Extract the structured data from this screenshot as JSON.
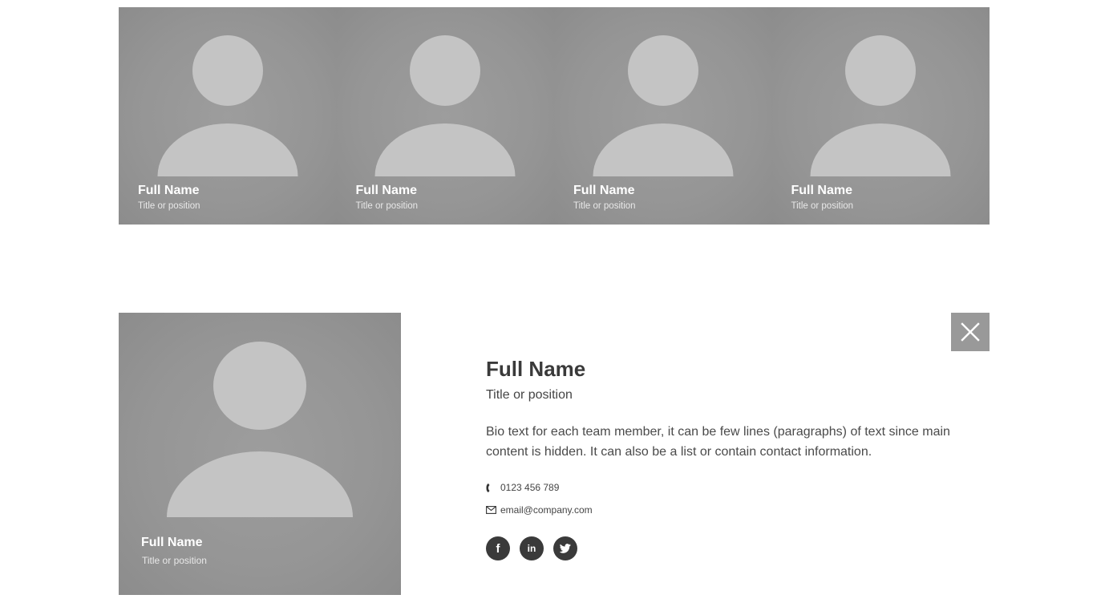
{
  "members": [
    {
      "name": "Full Name",
      "position": "Title or position"
    },
    {
      "name": "Full Name",
      "position": "Title or position"
    },
    {
      "name": "Full Name",
      "position": "Title or position"
    },
    {
      "name": "Full Name",
      "position": "Title or position"
    }
  ],
  "detail": {
    "photo_name": "Full Name",
    "photo_position": "Title or position",
    "name": "Full Name",
    "position": "Title or position",
    "bio": "Bio text for each team member, it can be few lines (paragraphs) of text since main content is hidden. It can also be a list or contain contact information.",
    "phone": "0123 456 789",
    "email": "email@company.com",
    "social": [
      {
        "icon": "facebook-icon",
        "glyph": "f"
      },
      {
        "icon": "linkedin-icon",
        "glyph": "in"
      },
      {
        "icon": "twitter-icon",
        "glyph": ""
      }
    ]
  },
  "colors": {
    "card_bg": "#959595",
    "silhouette": "#c4c4c4",
    "close_bg": "#999999",
    "social_bg": "#3a3a3a"
  }
}
